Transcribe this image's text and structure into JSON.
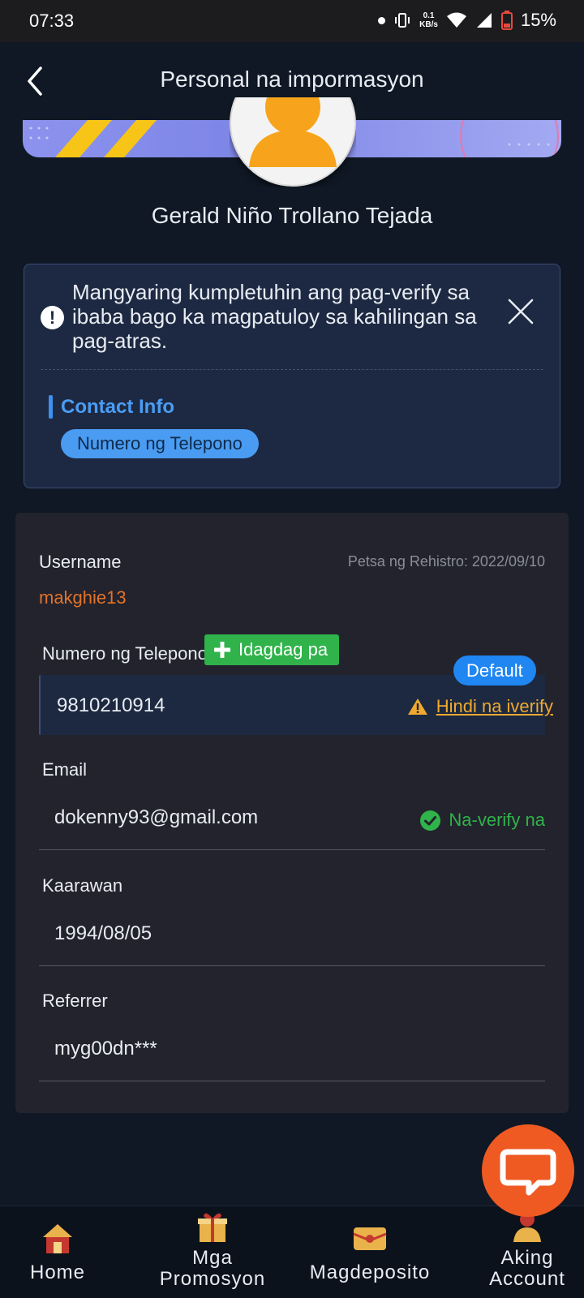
{
  "status_bar": {
    "time": "07:33",
    "net_speed_top": "0.1",
    "net_speed_bottom": "KB/s",
    "battery": "15%"
  },
  "header": {
    "title": "Personal na impormasyon"
  },
  "profile": {
    "name": "Gerald Niño Trollano Tejada"
  },
  "notice": {
    "text": "Mangyaring kumpletuhin ang pag-verify sa ibaba bago ka magpatuloy sa kahilingan sa pag-atras.",
    "section_title": "Contact Info",
    "chip_label": "Numero ng Telepono"
  },
  "info": {
    "username_label": "Username",
    "username_value": "makghie13",
    "registration": "Petsa ng Rehistro: 2022/09/10",
    "phone_label": "Numero ng Telepono",
    "add_label": "Idagdag pa",
    "phone_value": "9810210914",
    "default_label": "Default",
    "phone_status": "Hindi na iverify",
    "email_label": "Email",
    "email_value": "dokenny93@gmail.com",
    "email_status": "Na-verify na",
    "birthday_label": "Kaarawan",
    "birthday_value": "1994/08/05",
    "referrer_label": "Referrer",
    "referrer_value": "myg00dn***"
  },
  "bottom_nav": {
    "home": "Home",
    "promos_line1": "Mga",
    "promos_line2": "Promosyon",
    "deposit": "Magdeposito",
    "account_line1": "Aking",
    "account_line2": "Account"
  },
  "colors": {
    "background": "#0f1824",
    "accent_blue": "#1f86f2",
    "success_green": "#2fb34a",
    "warning_orange": "#f0a930",
    "chat_orange": "#ef5a23",
    "username_orange": "#e0732a"
  },
  "icons": {
    "back": "chevron-left-icon",
    "notice": "exclamation-icon",
    "close": "close-icon",
    "add": "plus-icon",
    "warning": "warning-icon",
    "verified": "check-circle-icon",
    "chat": "chat-bubble-icon"
  }
}
